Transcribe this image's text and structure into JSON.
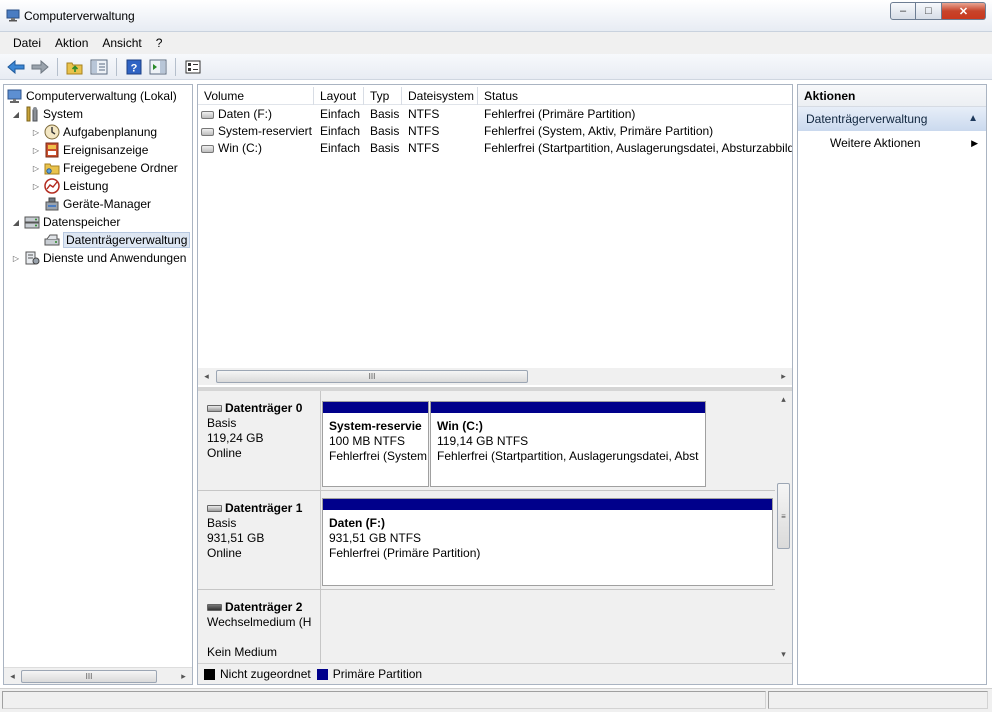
{
  "window": {
    "title": "Computerverwaltung",
    "minimize": "–",
    "maximize": "□",
    "close": "✕"
  },
  "menu": [
    "Datei",
    "Aktion",
    "Ansicht",
    "?"
  ],
  "toolbar": {
    "icons": [
      "back-arrow-icon",
      "forward-arrow-icon",
      "up-folder-icon",
      "show-tree-icon",
      "help-icon",
      "show-action-pane-icon",
      "properties-icon"
    ]
  },
  "tree": {
    "items": [
      {
        "label": "Computerverwaltung (Lokal)",
        "icon": "computer-management-icon",
        "toggle": ""
      },
      {
        "label": "System",
        "icon": "system-tools-icon",
        "toggle": "◢"
      },
      {
        "label": "Aufgabenplanung",
        "icon": "clock-icon",
        "toggle": "▷"
      },
      {
        "label": "Ereignisanzeige",
        "icon": "event-viewer-icon",
        "toggle": "▷"
      },
      {
        "label": "Freigegebene Ordner",
        "icon": "shared-folder-icon",
        "toggle": "▷"
      },
      {
        "label": "Leistung",
        "icon": "performance-icon",
        "toggle": "▷"
      },
      {
        "label": "Geräte-Manager",
        "icon": "device-manager-icon",
        "toggle": ""
      },
      {
        "label": "Datenspeicher",
        "icon": "storage-icon",
        "toggle": "◢"
      },
      {
        "label": "Datenträgerverwaltung",
        "icon": "disk-management-icon",
        "toggle": ""
      },
      {
        "label": "Dienste und Anwendungen",
        "icon": "services-icon",
        "toggle": "▷"
      }
    ],
    "hscroll_thumb": "III",
    "left_arrow": "◂",
    "right_arrow": "▸"
  },
  "volumes": {
    "headers": [
      "Volume",
      "Layout",
      "Typ",
      "Dateisystem",
      "Status"
    ],
    "rows": [
      {
        "volume": "Daten (F:)",
        "layout": "Einfach",
        "typ": "Basis",
        "fs": "NTFS",
        "status": "Fehlerfrei (Primäre Partition)"
      },
      {
        "volume": "System-reserviert",
        "layout": "Einfach",
        "typ": "Basis",
        "fs": "NTFS",
        "status": "Fehlerfrei (System, Aktiv, Primäre Partition)"
      },
      {
        "volume": "Win  (C:)",
        "layout": "Einfach",
        "typ": "Basis",
        "fs": "NTFS",
        "status": "Fehlerfrei (Startpartition, Auslagerungsdatei, Absturzabbild"
      }
    ],
    "hscroll_thumb": "III",
    "left_arrow": "◂",
    "right_arrow": "▸"
  },
  "disks": [
    {
      "name": "Datenträger 0",
      "type": "Basis",
      "size": "119,24 GB",
      "state": "Online",
      "partitions": [
        {
          "title": "System-reservie",
          "size": "100 MB NTFS",
          "status": "Fehlerfrei (System"
        },
        {
          "title": "Win   (C:)",
          "size": "119,14 GB NTFS",
          "status": "Fehlerfrei (Startpartition, Auslagerungsdatei, Abst"
        }
      ]
    },
    {
      "name": "Datenträger 1",
      "type": "Basis",
      "size": "931,51 GB",
      "state": "Online",
      "partitions": [
        {
          "title": "Daten  (F:)",
          "size": "931,51 GB NTFS",
          "status": "Fehlerfrei (Primäre Partition)"
        }
      ]
    },
    {
      "name": "Datenträger 2",
      "type": "Wechselmedium (H",
      "size": "",
      "state": "Kein Medium",
      "partitions": []
    }
  ],
  "disk_scroll": {
    "up": "▴",
    "down": "▾",
    "thumb": "≡"
  },
  "legend": [
    {
      "label": "Nicht zugeordnet",
      "color": "#000000"
    },
    {
      "label": "Primäre Partition",
      "color": "#00008b"
    }
  ],
  "actions": {
    "header": "Aktionen",
    "section": "Datenträgerverwaltung",
    "section_caret": "▲",
    "items": [
      {
        "label": "Weitere Aktionen",
        "arrow": "▶"
      }
    ]
  }
}
